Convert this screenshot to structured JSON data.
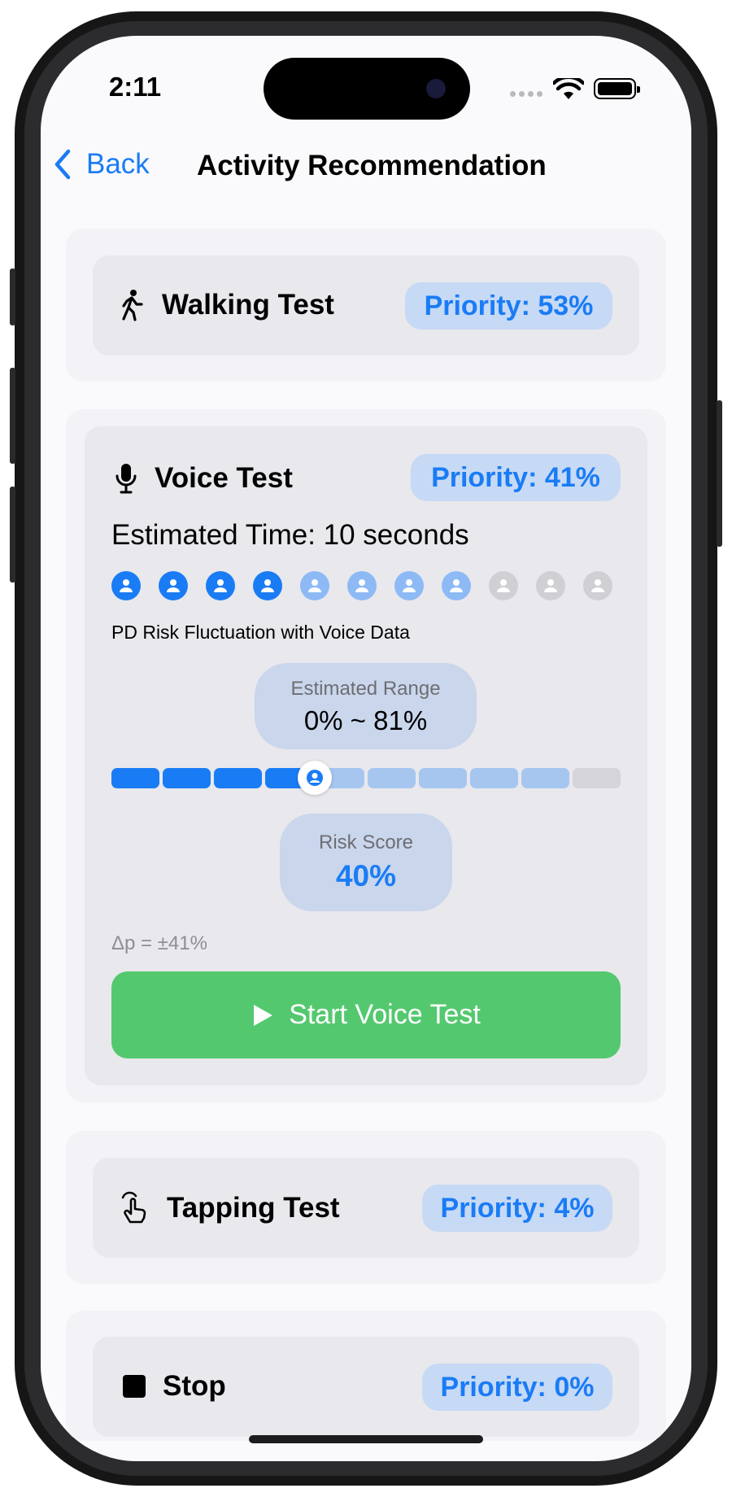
{
  "status_bar": {
    "time": "2:11"
  },
  "nav": {
    "back_label": "Back",
    "title": "Activity Recommendation"
  },
  "activities": {
    "walking": {
      "name": "Walking Test",
      "priority": "Priority: 53%",
      "icon": "walking-person-icon"
    },
    "voice": {
      "name": "Voice Test",
      "priority": "Priority: 41%",
      "icon": "microphone-icon",
      "estimated_time": "Estimated Time: 10 seconds",
      "people_dots": {
        "total": 11,
        "strong": 4,
        "light": 4,
        "empty": 3
      },
      "chart_label": "PD Risk Fluctuation with Voice Data",
      "estimated_range_label": "Estimated Range",
      "estimated_range_value": "0% ~ 81%",
      "range_bar": {
        "segments": 10,
        "strong": 4,
        "light": 5,
        "empty": 1,
        "marker_percent": 40
      },
      "risk_score_label": "Risk Score",
      "risk_score_value": "40%",
      "delta": "Δp = ±41%",
      "start_button": "Start Voice Test"
    },
    "tapping": {
      "name": "Tapping Test",
      "priority": "Priority: 4%",
      "icon": "tapping-hand-icon"
    },
    "stop": {
      "name": "Stop",
      "priority": "Priority: 0%",
      "icon": "stop-square-icon"
    }
  },
  "colors": {
    "accent": "#1a7cf5",
    "accent_light": "#8dbaf5",
    "start_green": "#54c86f",
    "pill_bg": "#c6d9f5"
  }
}
